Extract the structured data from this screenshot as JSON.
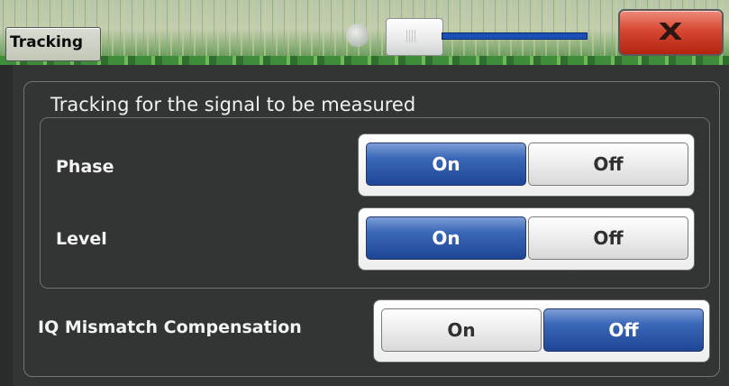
{
  "window": {
    "title": "Tracking",
    "close_label": "X"
  },
  "group": {
    "title": "Tracking for the signal to be measured"
  },
  "settings": [
    {
      "label": "Phase",
      "on_label": "On",
      "off_label": "Off",
      "selected": "On"
    },
    {
      "label": "Level",
      "on_label": "On",
      "off_label": "Off",
      "selected": "On"
    }
  ],
  "iq_mismatch": {
    "label": "IQ Mismatch Compensation",
    "on_label": "On",
    "off_label": "Off",
    "selected": "Off"
  },
  "colors": {
    "active_button": "#2b57a8",
    "close_button": "#c8331d",
    "panel_background": "#333535"
  }
}
